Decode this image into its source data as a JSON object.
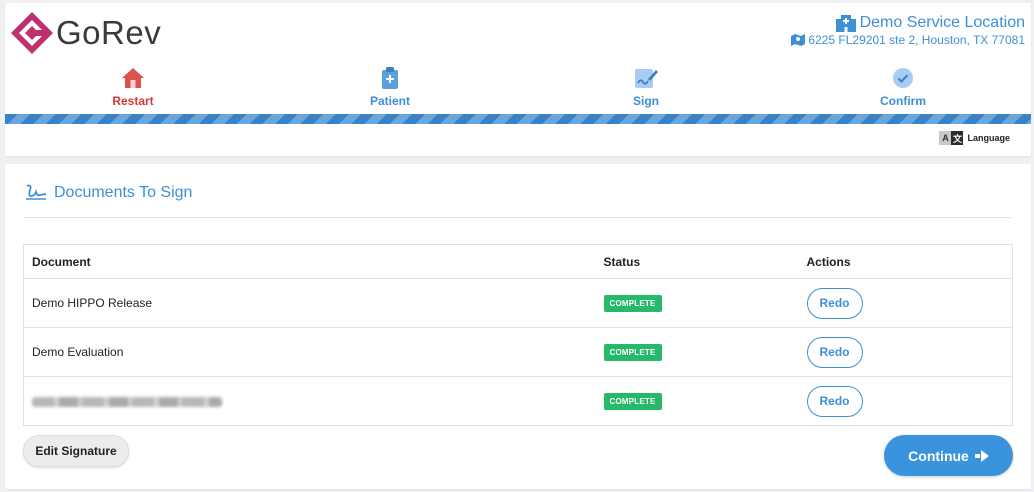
{
  "brand": {
    "name": "GoRev",
    "color": "#c0306e"
  },
  "location": {
    "name": "Demo Service Location",
    "address": "6225 FL29201 ste 2, Houston, TX 77081"
  },
  "steps": [
    {
      "label": "Restart",
      "icon": "home-icon",
      "active": true
    },
    {
      "label": "Patient",
      "icon": "clipboard-icon",
      "active": false
    },
    {
      "label": "Sign",
      "icon": "signature-icon",
      "active": false
    },
    {
      "label": "Confirm",
      "icon": "check-circle-icon",
      "active": false
    }
  ],
  "language": {
    "label": "Language",
    "icon_a": "A",
    "icon_b": "文"
  },
  "documents": {
    "title": "Documents To Sign",
    "headers": {
      "document": "Document",
      "status": "Status",
      "actions": "Actions"
    },
    "rows": [
      {
        "document": "Demo HIPPO Release",
        "status": "COMPLETE",
        "action": "Redo"
      },
      {
        "document": "Demo Evaluation",
        "status": "COMPLETE",
        "action": "Redo"
      },
      {
        "document": "",
        "status": "COMPLETE",
        "action": "Redo"
      }
    ]
  },
  "buttons": {
    "edit_signature": "Edit Signature",
    "continue": "Continue"
  },
  "colors": {
    "accent": "#3d8fd6",
    "active": "#d43a3a",
    "complete": "#27b96a"
  }
}
